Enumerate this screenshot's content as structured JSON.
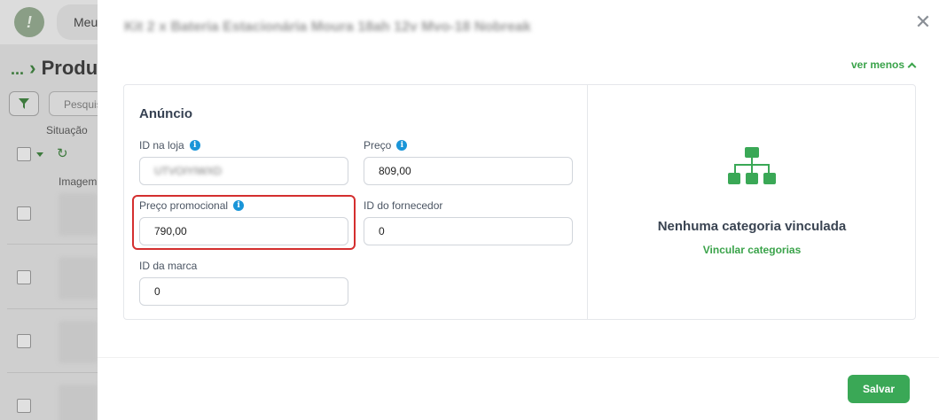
{
  "background": {
    "nav_tab_label": "Meu",
    "breadcrumb_dots": "...",
    "page_title": "Produ",
    "search_placeholder": "Pesquis",
    "situacao_label": "Situação",
    "imagem_header": "Imagem"
  },
  "modal": {
    "title": "Kit 2 x Bateria Estacionária Moura 18ah 12v Mvo-18 Nobreak",
    "ver_menos_label": "ver menos",
    "section_title": "Anúncio",
    "fields": {
      "id_na_loja": {
        "label": "ID na loja",
        "value": "UTVOIYIWXD"
      },
      "preco": {
        "label": "Preço",
        "value": "809,00"
      },
      "preco_promocional": {
        "label": "Preço promocional",
        "value": "790,00"
      },
      "id_fornecedor": {
        "label": "ID do fornecedor",
        "value": "0"
      },
      "id_marca": {
        "label": "ID da marca",
        "value": "0"
      }
    },
    "categories": {
      "empty_text": "Nenhuma categoria vinculada",
      "link_label": "Vincular categorias"
    },
    "save_label": "Salvar",
    "close_symbol": "✕"
  },
  "colors": {
    "accent_green": "#3aa34a",
    "highlight_red": "#d42f2f",
    "info_blue": "#1a95d8"
  }
}
